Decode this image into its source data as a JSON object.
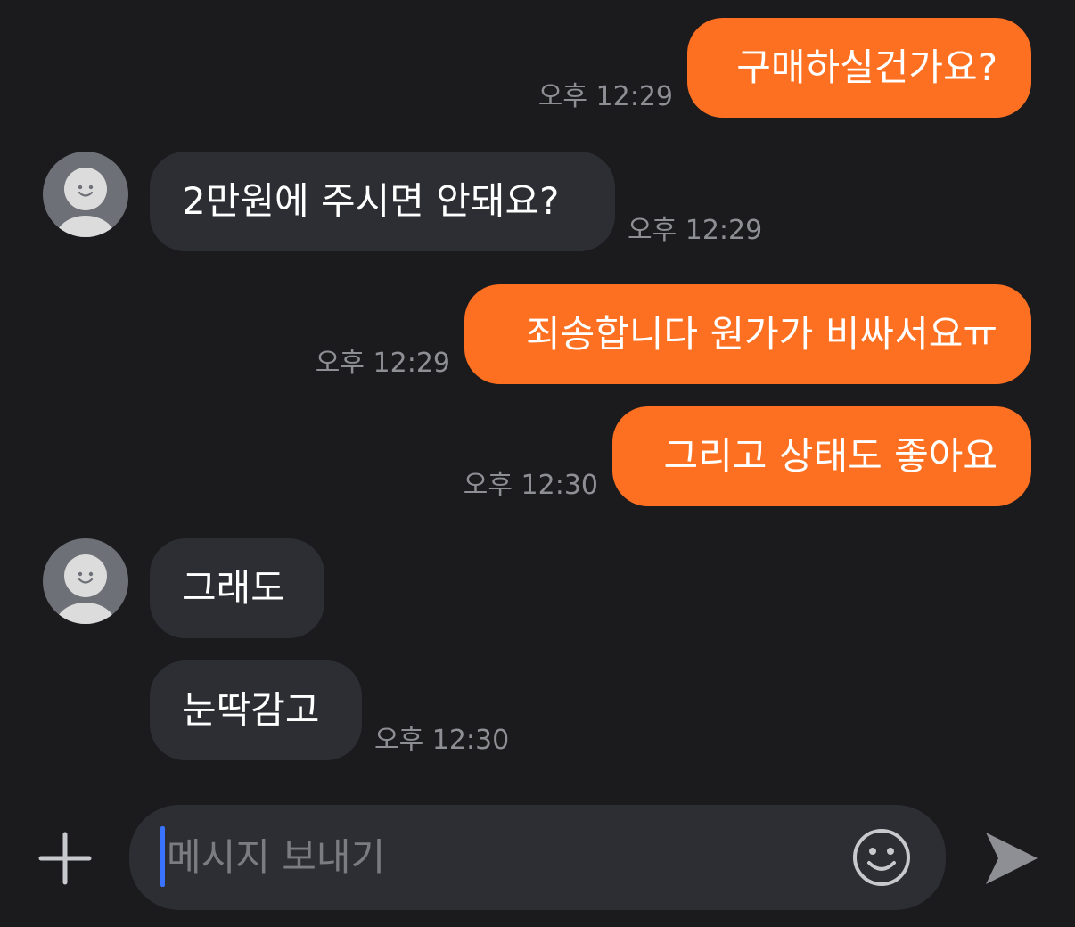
{
  "messages": [
    {
      "direction": "out",
      "text": "구매하실건가요?",
      "time": "오후 12:29"
    },
    {
      "direction": "in",
      "text": "2만원에 주시면 안돼요?",
      "time": "오후 12:29"
    },
    {
      "direction": "out",
      "text": "죄송합니다 원가가 비싸서요ㅠ",
      "time": "오후 12:29"
    },
    {
      "direction": "out",
      "text": "그리고 상태도 좋아요",
      "time": "오후 12:30"
    },
    {
      "direction": "in",
      "text": "그래도",
      "time": ""
    },
    {
      "direction": "in",
      "text": "눈딱감고",
      "time": "오후 12:30"
    }
  ],
  "composer": {
    "placeholder": "메시지 보내기",
    "plus_icon": "plus-icon",
    "emoji_icon": "smiley-icon",
    "send_icon": "send-icon"
  },
  "colors": {
    "background": "#1b1b1e",
    "outgoing_bubble": "#fe7021",
    "incoming_bubble": "#2c2e33",
    "timestamp": "#8e8f94",
    "caret": "#3a73ff"
  }
}
